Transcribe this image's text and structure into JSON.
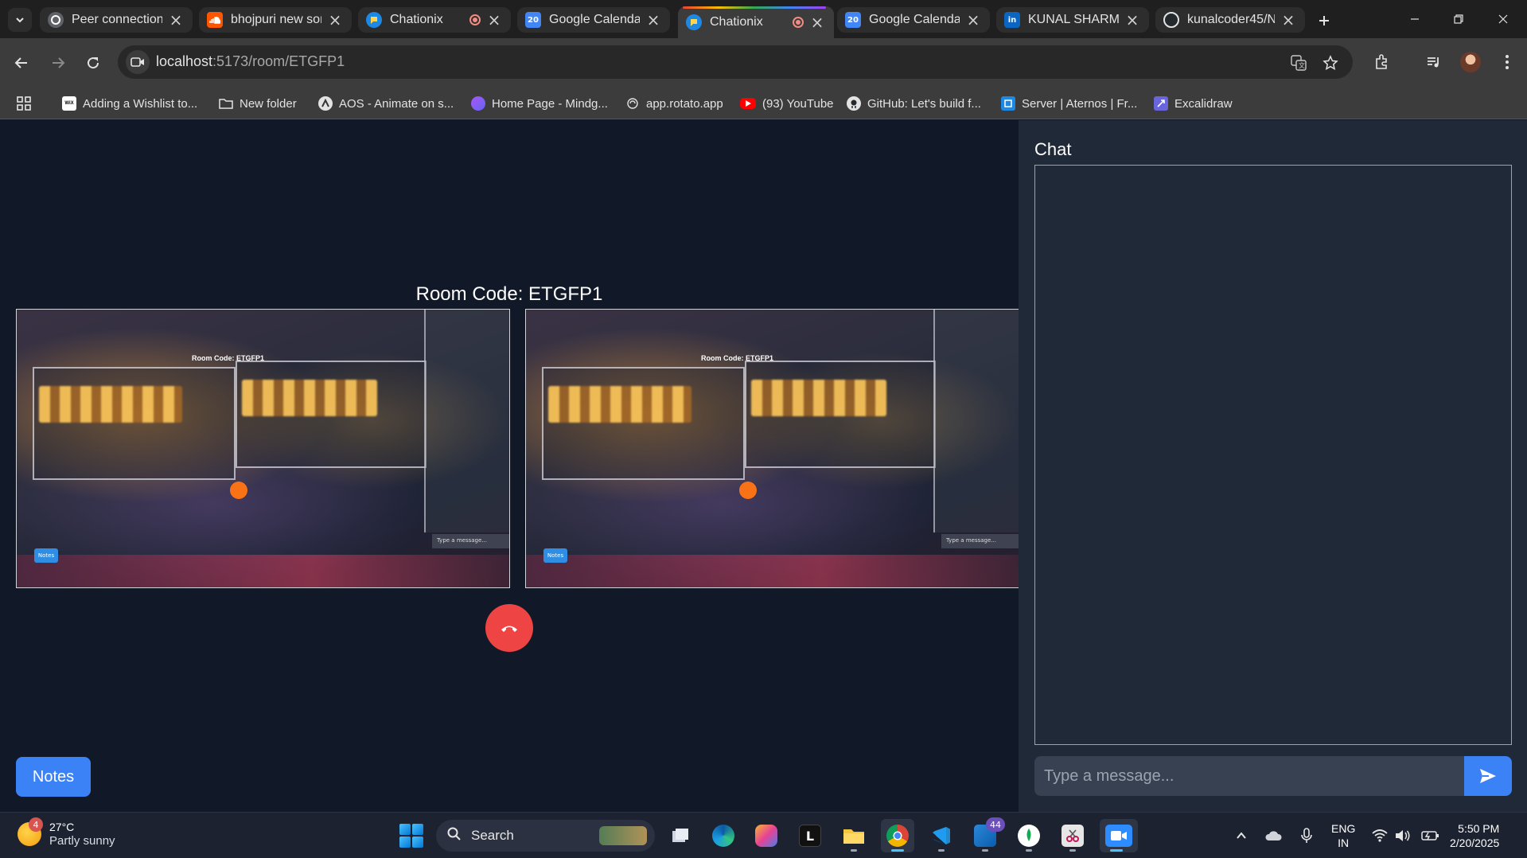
{
  "browser": {
    "tabs": [
      {
        "title": "Peer connection",
        "icon": "peer-icon",
        "active": false,
        "recording": false
      },
      {
        "title": "bhojpuri new sor",
        "icon": "soundcloud-icon",
        "active": false,
        "recording": false
      },
      {
        "title": "Chationix",
        "icon": "chationix-icon",
        "active": false,
        "recording": true
      },
      {
        "title": "Google Calendar",
        "icon": "calendar-icon",
        "active": false,
        "recording": false
      },
      {
        "title": "Chationix",
        "icon": "chationix-icon",
        "active": true,
        "recording": true
      },
      {
        "title": "Google Calendar",
        "icon": "calendar-icon",
        "active": false,
        "recording": false
      },
      {
        "title": "KUNAL SHARMA",
        "icon": "linkedin-icon",
        "active": false,
        "recording": false
      },
      {
        "title": "kunalcoder45/N",
        "icon": "github-icon",
        "active": false,
        "recording": false
      }
    ],
    "calendar_icon_text": "20",
    "linkedin_icon_text": "in",
    "address": {
      "host": "localhost",
      "path": ":5173/room/ETGFP1"
    },
    "bookmarks": [
      {
        "label": "Adding a Wishlist to...",
        "icon": "wix-icon",
        "icon_text": "WiX"
      },
      {
        "label": "New folder",
        "icon": "folder-icon",
        "icon_text": ""
      },
      {
        "label": "AOS - Animate on s...",
        "icon": "aos-icon",
        "icon_text": ""
      },
      {
        "label": "Home Page - Mindg...",
        "icon": "mindgrasp-icon",
        "icon_text": ""
      },
      {
        "label": "app.rotato.app",
        "icon": "rotato-icon",
        "icon_text": ""
      },
      {
        "label": "(93) YouTube",
        "icon": "youtube-icon",
        "icon_text": ""
      },
      {
        "label": "GitHub: Let's build f...",
        "icon": "github-icon",
        "icon_text": ""
      },
      {
        "label": "Server | Aternos | Fr...",
        "icon": "aternos-icon",
        "icon_text": ""
      },
      {
        "label": "Excalidraw",
        "icon": "excalidraw-icon",
        "icon_text": ""
      }
    ]
  },
  "room": {
    "code_label": "Room Code: ETGFP1",
    "inner_code_label": "Room Code: ETGFP1",
    "inner_notes": "Notes",
    "inner_type": "Type a message...",
    "end_call_icon": "phone-hangup-icon",
    "notes_button": "Notes"
  },
  "chat": {
    "title": "Chat",
    "input_placeholder": "Type a message...",
    "send_icon": "send-icon"
  },
  "taskbar": {
    "weather": {
      "badge": "4",
      "temp": "27°C",
      "desc": "Partly sunny"
    },
    "search_label": "Search",
    "pinned_letter_l": "L",
    "notification_badge": "44",
    "lang_top": "ENG",
    "lang_bottom": "IN",
    "time": "5:50 PM",
    "date": "2/20/2025"
  },
  "colors": {
    "page_bg": "#111827",
    "chat_bg": "#1f2937",
    "accent_blue": "#3b82f6",
    "end_call_red": "#ef4444"
  }
}
